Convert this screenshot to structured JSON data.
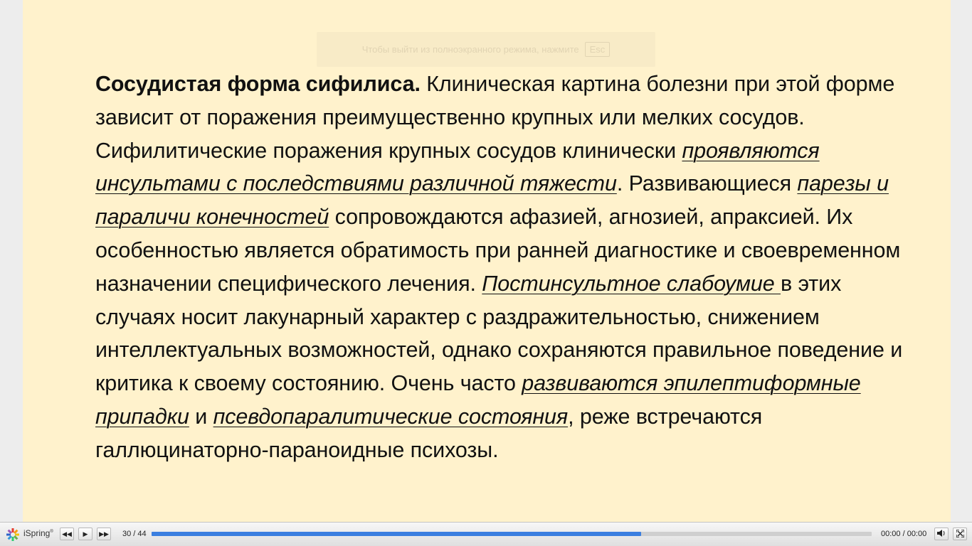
{
  "slide": {
    "toast_text": "Чтобы выйти из полноэкранного режима, нажмите",
    "toast_key": "Esc",
    "paragraph": [
      {
        "text": "Сосудистая форма сифилиса.",
        "style": "bold"
      },
      {
        "text": " Клиническая картина болезни при этой форме зависит от поражения преимущественно крупных или мелких сосудов. Сифилитические поражения крупных сосудов клинически ",
        "style": "normal"
      },
      {
        "text": "проявляются инсультами с последствиями различной тяжести",
        "style": "italic-underline"
      },
      {
        "text": ". Развивающиеся ",
        "style": "normal"
      },
      {
        "text": "парезы и параличи конечностей",
        "style": "italic-underline"
      },
      {
        "text": " сопровождаются афазией, агнозией, апраксией. Их особенностью является обратимость при ранней диагностике и своевременном назначении специфического лечения. ",
        "style": "normal"
      },
      {
        "text": "Постинсультное слабоумие ",
        "style": "italic-underline"
      },
      {
        "text": "в этих случаях носит лакунарный характер с раздражительностью, снижением интеллектуальных возможностей, однако сохраняются правильное поведение и критика к своему состоянию. Очень часто ",
        "style": "normal"
      },
      {
        "text": "развиваются эпилептиформные припадки",
        "style": "italic-underline"
      },
      {
        "text": " и ",
        "style": "normal"
      },
      {
        "text": "псевдопаралитические состояния",
        "style": "italic-underline"
      },
      {
        "text": ", реже встречаются галлюцинаторно-параноидные психозы.",
        "style": "normal"
      }
    ]
  },
  "player": {
    "brand": "iSpring",
    "brand_mark": "®",
    "counter": "30 / 44",
    "progress_fraction": 0.68,
    "time": "00:00 / 00:00",
    "icons": {
      "logo": "ispring-logo-icon",
      "prev": "rewind-icon",
      "play": "play-icon",
      "next": "fast-forward-icon",
      "volume": "volume-icon",
      "fullscreen": "fullscreen-icon"
    },
    "colors": {
      "progress_fill": "#3b7fe0",
      "slide_background": "#fff2cc"
    }
  }
}
